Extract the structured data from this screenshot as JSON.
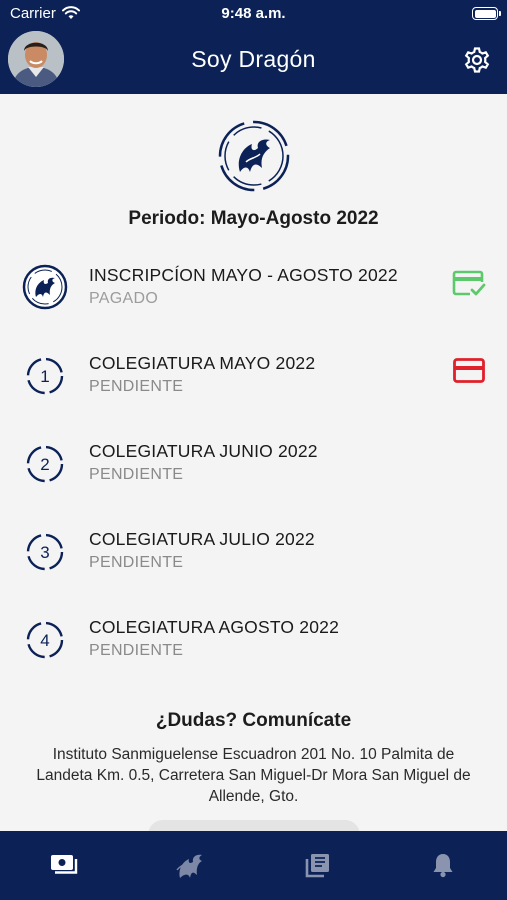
{
  "status_bar": {
    "carrier": "Carrier",
    "time": "9:48 a.m."
  },
  "header": {
    "title": "Soy Dragón",
    "avatar_icon": "user-avatar",
    "settings_icon": "gear-icon"
  },
  "main": {
    "logo_icon": "dragon-logo",
    "period": "Periodo: Mayo-Agosto 2022",
    "payments": [
      {
        "title": "INSCRIPCÍON MAYO - AGOSTO 2022",
        "status": "PAGADO",
        "badge": "",
        "icon": "dragon-logo",
        "action_icon": "paid-card-icon"
      },
      {
        "title": "COLEGIATURA MAYO 2022",
        "status": "PENDIENTE",
        "badge": "1",
        "icon": "number-circle",
        "action_icon": "pay-card-icon"
      },
      {
        "title": "COLEGIATURA JUNIO 2022",
        "status": "PENDIENTE",
        "badge": "2",
        "icon": "number-circle",
        "action_icon": ""
      },
      {
        "title": "COLEGIATURA JULIO 2022",
        "status": "PENDIENTE",
        "badge": "3",
        "icon": "number-circle",
        "action_icon": ""
      },
      {
        "title": "COLEGIATURA AGOSTO 2022",
        "status": "PENDIENTE",
        "badge": "4",
        "icon": "number-circle",
        "action_icon": ""
      }
    ],
    "help_title": "¿Dudas? Comunícate",
    "address": "Instituto Sanmiguelense Escuadron 201 No. 10 Palmita de Landeta Km. 0.5, Carretera San Miguel-Dr Mora San Miguel de Allende, Gto."
  },
  "tabbar": {
    "tabs": [
      {
        "icon": "payments-icon",
        "active": true
      },
      {
        "icon": "dragon-logo-icon",
        "active": false
      },
      {
        "icon": "library-icon",
        "active": false
      },
      {
        "icon": "bell-icon",
        "active": false
      }
    ]
  },
  "colors": {
    "primary": "#0c2257",
    "background": "#f4f4f4",
    "paid": "#5cc96b",
    "pending_action": "#e0202a",
    "muted_text": "#8a8a8a"
  }
}
